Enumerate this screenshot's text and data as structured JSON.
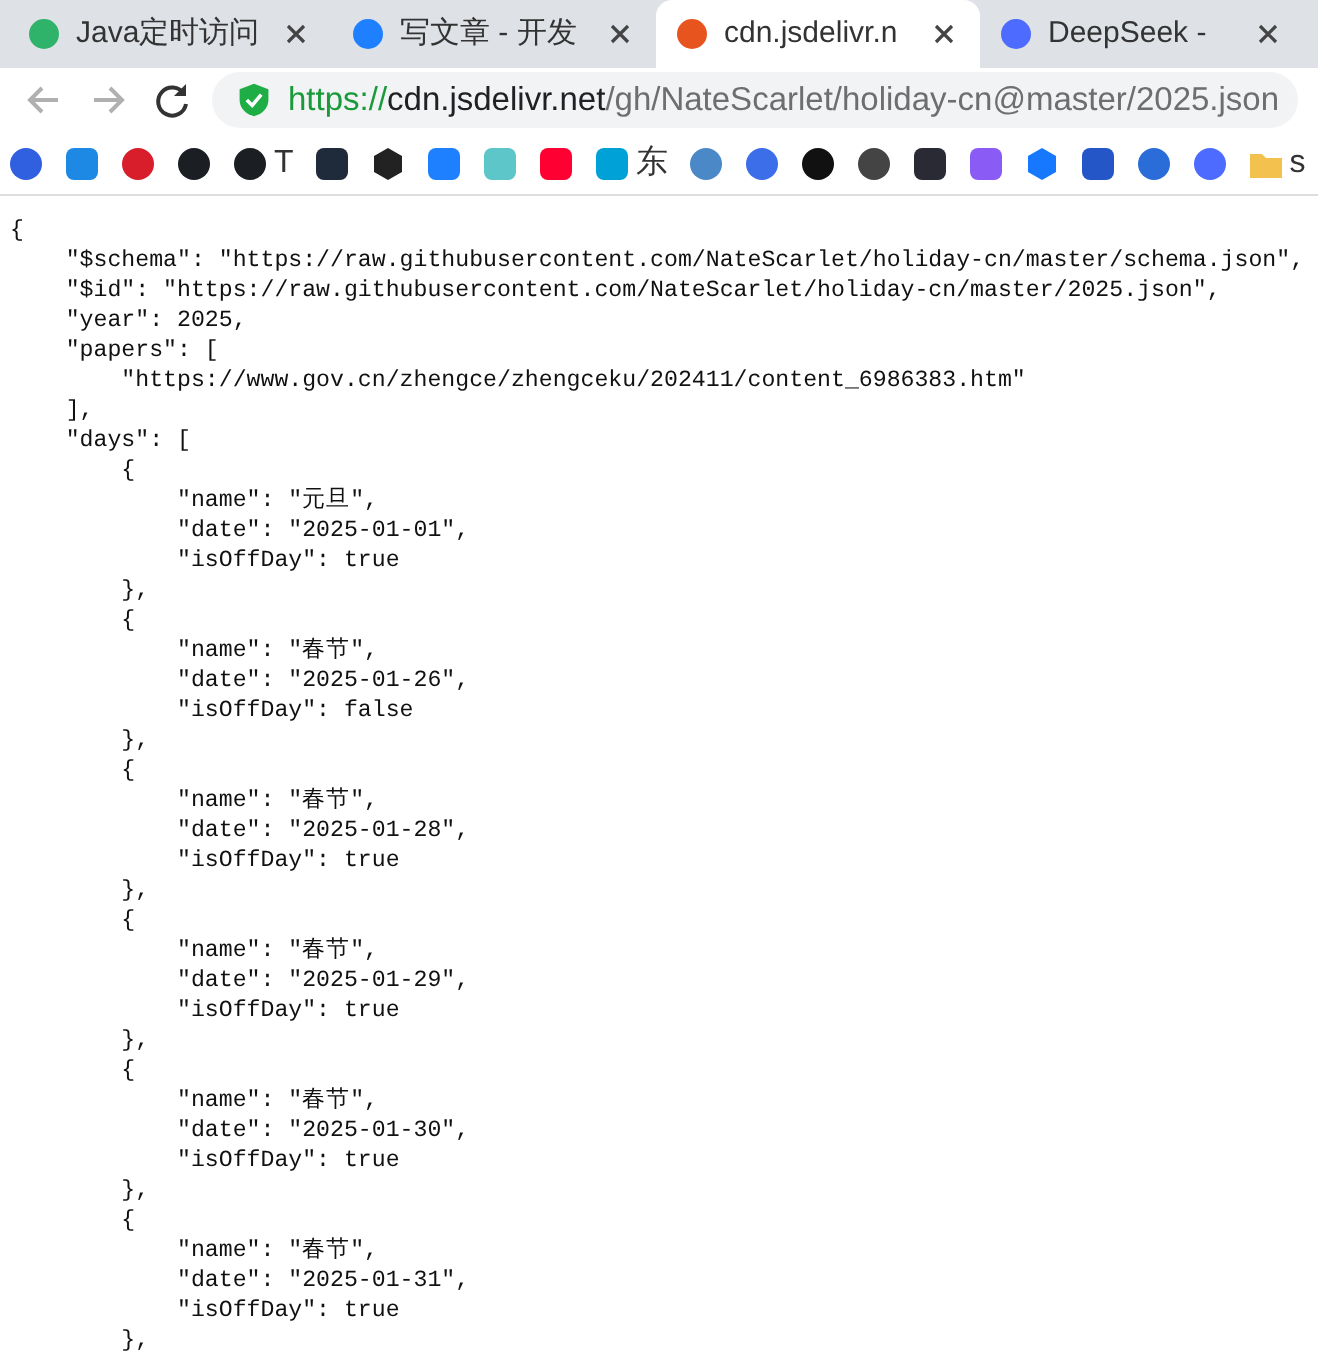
{
  "tabs": [
    {
      "title": "Java定时访问",
      "selected": false,
      "color": "#2fb36a"
    },
    {
      "title": "写文章 - 开发",
      "selected": false,
      "color": "#1e80ff"
    },
    {
      "title": "cdn.jsdelivr.n",
      "selected": true,
      "color": "#e8541e"
    },
    {
      "title": "DeepSeek -",
      "selected": false,
      "color": "#4d6bfe"
    }
  ],
  "address": {
    "scheme": "https://",
    "host": "cdn.jsdelivr.net",
    "path": "/gh/NateScarlet/holiday-cn@master/2025.json"
  },
  "bookmarks": [
    {
      "kind": "circle",
      "color": "#3060e0"
    },
    {
      "kind": "square",
      "color": "#1e88e5"
    },
    {
      "kind": "circle",
      "color": "#d81e2a"
    },
    {
      "kind": "circle",
      "color": "#1b1f23"
    },
    {
      "kind": "circle",
      "color": "#1b1f23",
      "label": "T"
    },
    {
      "kind": "square",
      "color": "#1f2a3a"
    },
    {
      "kind": "hexagon",
      "color": "#222222"
    },
    {
      "kind": "square",
      "color": "#1e80ff"
    },
    {
      "kind": "square",
      "color": "#5cc6c8"
    },
    {
      "kind": "square",
      "color": "#ff0033"
    },
    {
      "kind": "square",
      "color": "#00a1d6",
      "label": "东"
    },
    {
      "kind": "circle",
      "color": "#4a88c8"
    },
    {
      "kind": "circle",
      "color": "#3b6ee8"
    },
    {
      "kind": "circle",
      "color": "#111111"
    },
    {
      "kind": "circle",
      "color": "#444444"
    },
    {
      "kind": "square",
      "color": "#2a2a35"
    },
    {
      "kind": "square",
      "color": "#8a5cf5"
    },
    {
      "kind": "hexagon",
      "color": "#1677ff"
    },
    {
      "kind": "square",
      "color": "#2456c8"
    },
    {
      "kind": "circle",
      "color": "#2a6cd8"
    },
    {
      "kind": "circle",
      "color": "#4d6bfe"
    },
    {
      "kind": "folder",
      "color": "#f2c14e",
      "label": "s"
    }
  ],
  "document": {
    "text": "{\n    \"$schema\": \"https://raw.githubusercontent.com/NateScarlet/holiday-cn/master/schema.json\",\n    \"$id\": \"https://raw.githubusercontent.com/NateScarlet/holiday-cn/master/2025.json\",\n    \"year\": 2025,\n    \"papers\": [\n        \"https://www.gov.cn/zhengce/zhengceku/202411/content_6986383.htm\"\n    ],\n    \"days\": [\n        {\n            \"name\": \"元旦\",\n            \"date\": \"2025-01-01\",\n            \"isOffDay\": true\n        },\n        {\n            \"name\": \"春节\",\n            \"date\": \"2025-01-26\",\n            \"isOffDay\": false\n        },\n        {\n            \"name\": \"春节\",\n            \"date\": \"2025-01-28\",\n            \"isOffDay\": true\n        },\n        {\n            \"name\": \"春节\",\n            \"date\": \"2025-01-29\",\n            \"isOffDay\": true\n        },\n        {\n            \"name\": \"春节\",\n            \"date\": \"2025-01-30\",\n            \"isOffDay\": true\n        },\n        {\n            \"name\": \"春节\",\n            \"date\": \"2025-01-31\",\n            \"isOffDay\": true\n        },"
  }
}
